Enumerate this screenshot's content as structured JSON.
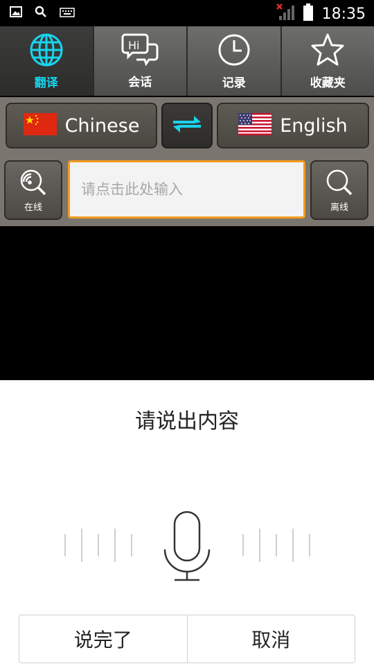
{
  "status_bar": {
    "time": "18:35",
    "icons": [
      "image-icon",
      "search-icon",
      "keyboard-icon",
      "signal-icon",
      "battery-icon"
    ]
  },
  "tabs": [
    {
      "label": "翻译",
      "icon": "globe-icon",
      "active": true
    },
    {
      "label": "会话",
      "icon": "chat-hi-icon",
      "active": false
    },
    {
      "label": "记录",
      "icon": "clock-icon",
      "active": false
    },
    {
      "label": "收藏夹",
      "icon": "star-icon",
      "active": false
    }
  ],
  "languages": {
    "source": {
      "label": "Chinese",
      "flag": "china-flag-icon"
    },
    "target": {
      "label": "English",
      "flag": "usa-flag-icon"
    },
    "swap_icon": "swap-arrows-icon"
  },
  "search": {
    "online_label": "在线",
    "offline_label": "离线",
    "placeholder": "请点击此处输入"
  },
  "voice_dialog": {
    "prompt": "请说出内容",
    "done_label": "说完了",
    "cancel_label": "取消"
  },
  "colors": {
    "accent": "#18d4ee",
    "input_border": "#f39a1e"
  }
}
